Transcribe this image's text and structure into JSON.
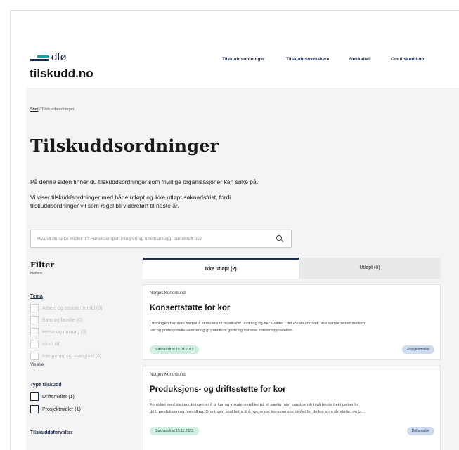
{
  "header": {
    "logo_text": "dfø",
    "site_name": "tilskudd.no",
    "nav": [
      "Tilskuddsordninger",
      "Tilskuddsmottakere",
      "Nøkkeltall",
      "Om tilskudd.no"
    ]
  },
  "breadcrumb": {
    "start": "Start",
    "separator": "/",
    "current": "Tilskuddsordninger"
  },
  "page": {
    "title": "Tilskuddsordninger",
    "intro1": "På denne siden finner du tilskuddsordninger som frivillige organisasjoner kan søke på.",
    "intro2a": "Vi viser tilskuddsordninger med både utløpt og ikke utløpt søknadsfrist, fordi",
    "intro2b": "tilskuddsordninger vil som regel bli videreført til neste år."
  },
  "search": {
    "placeholder": "Hva vil du søke midler til? For eksempel: integrering, idrettsanlegg, bærekraft osv."
  },
  "filter": {
    "title": "Filter",
    "reset": "Nullstill",
    "tema_title": "Tema",
    "tema": [
      "Arbeid og sosiale formål (0)",
      "Barn og familie (0)",
      "Helse og omsorg (0)",
      "Idrett (0)",
      "Integrering og mangfold (0)"
    ],
    "show_all": "Vis alle",
    "type_title": "Type tilskudd",
    "type": [
      "Driftsmidler (1)",
      "Prosjektmidler (1)"
    ],
    "forvalter_title": "Tilskuddsforvalter"
  },
  "tabs": {
    "active": "Ikke utløpt (2)",
    "inactive": "Utløpt (0)"
  },
  "cards": [
    {
      "org": "Norges Korforbund",
      "title": "Konsertstøtte for kor",
      "desc1": "Ordningen har som formål å stimulere til musikalsk utvikling og økt kvalitet i det lokale korlivet, øke samarbeidet mellom",
      "desc2": "kor og profesjonelle aktører og gi publikum gode og varierte konsertopplevelser.",
      "deadline": "Søknadsfrist 15.03.2023",
      "type": "Prosjektmidler"
    },
    {
      "org": "Norges Korforbund",
      "title": "Produksjons- og driftsstøtte for kor",
      "desc1": "Formålet med støtteordningen er å gi kor og vokalensembler på et særlig høyt kunstnerisk nivå bedre betingelser for",
      "desc2": "drift, produksjon og formidling. Ordningen skal bidra til å høyne det kunstneriske nivået for de kor som får støtte, og bi...",
      "deadline": "Søknadsfrist 15.11.2023",
      "type": "Driftsmidler"
    }
  ]
}
